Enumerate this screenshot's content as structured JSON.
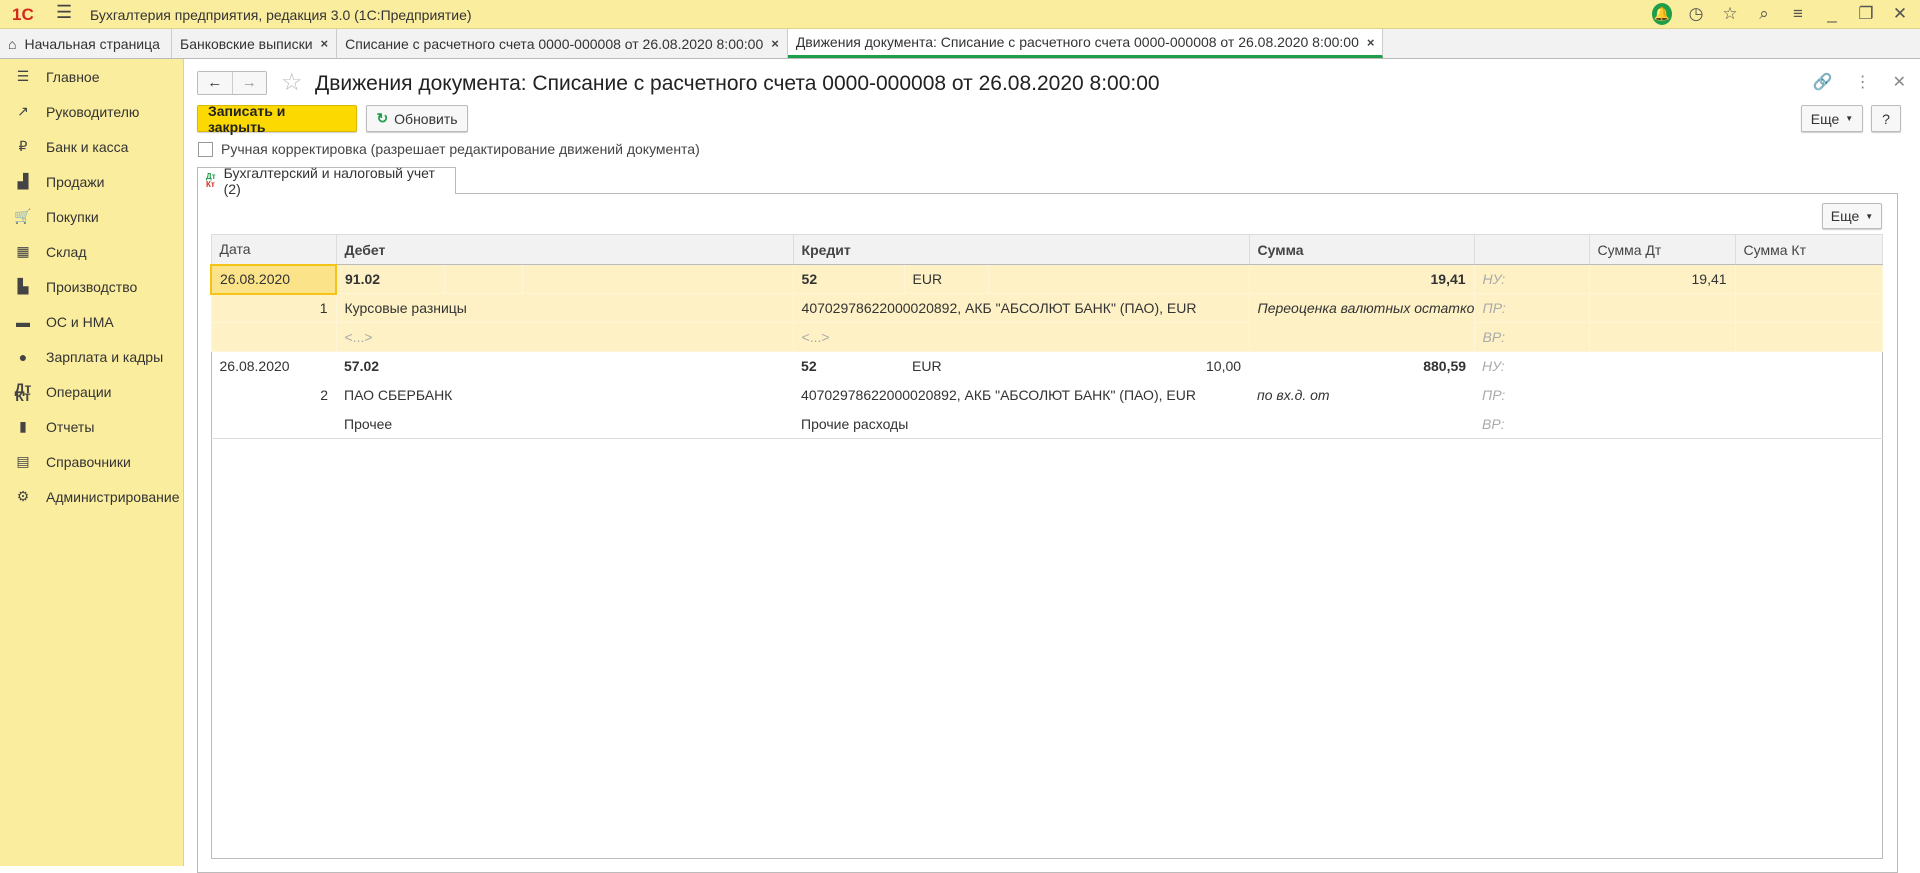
{
  "app": {
    "title": "Бухгалтерия предприятия, редакция 3.0  (1С:Предприятие)",
    "logo": "1С"
  },
  "tabs": [
    {
      "label": "Начальная страница"
    },
    {
      "label": "Банковские выписки"
    },
    {
      "label": "Списание с расчетного счета 0000-000008 от 26.08.2020 8:00:00"
    },
    {
      "label": "Движения документа: Списание с расчетного счета 0000-000008 от 26.08.2020 8:00:00"
    }
  ],
  "sidebar": {
    "items": [
      {
        "label": "Главное",
        "icon": "menu-icon"
      },
      {
        "label": "Руководителю",
        "icon": "trend-icon"
      },
      {
        "label": "Банк и касса",
        "icon": "ruble-icon"
      },
      {
        "label": "Продажи",
        "icon": "bag-icon"
      },
      {
        "label": "Покупки",
        "icon": "cart-icon"
      },
      {
        "label": "Склад",
        "icon": "warehouse-icon"
      },
      {
        "label": "Производство",
        "icon": "factory-icon"
      },
      {
        "label": "ОС и НМА",
        "icon": "truck-icon"
      },
      {
        "label": "Зарплата и кадры",
        "icon": "person-icon"
      },
      {
        "label": "Операции",
        "icon": "dtkt-icon"
      },
      {
        "label": "Отчеты",
        "icon": "chart-icon"
      },
      {
        "label": "Справочники",
        "icon": "books-icon"
      },
      {
        "label": "Администрирование",
        "icon": "gear-icon"
      }
    ]
  },
  "form": {
    "title": "Движения документа: Списание с расчетного счета 0000-000008 от 26.08.2020 8:00:00",
    "save_close": "Записать и закрыть",
    "refresh": "Обновить",
    "more": "Еще",
    "help": "?",
    "manual_label": "Ручная корректировка (разрешает редактирование движений документа)",
    "tab_label": "Бухгалтерский и налоговый учет (2)",
    "tab_icon_dt": "Дт",
    "tab_icon_kt": "Кт",
    "panel_more": "Еще"
  },
  "table": {
    "headers": [
      "Дата",
      "Дебет",
      "Кредит",
      "Сумма",
      "",
      "Сумма Дт",
      "Сумма Кт"
    ],
    "rows": [
      {
        "date": "26.08.2020",
        "num": "1",
        "dt_account": "91.02",
        "dt_sub1": "Курсовые разницы",
        "dt_sub2": "<...>",
        "kt_account": "52",
        "kt_currency": "EUR",
        "kt_amount_cur": "",
        "kt_sub1": "40702978622000020892, АКБ \"АБСОЛЮТ БАНК\" (ПАО), EUR",
        "kt_sub2": "<...>",
        "sum": "19,41",
        "content": "Переоценка валютных остатков",
        "nu": "НУ:",
        "pr": "ПР:",
        "vr": "ВР:",
        "sum_dt": "19,41",
        "sum_kt": ""
      },
      {
        "date": "26.08.2020",
        "num": "2",
        "dt_account": "57.02",
        "dt_sub1": "ПАО СБЕРБАНК",
        "dt_sub2": "Прочее",
        "kt_account": "52",
        "kt_currency": "EUR",
        "kt_amount_cur": "10,00",
        "kt_sub1": "40702978622000020892, АКБ \"АБСОЛЮТ БАНК\" (ПАО), EUR",
        "kt_sub2": "Прочие расходы",
        "sum": "880,59",
        "content": " по вх.д.  от",
        "nu": "НУ:",
        "pr": "ПР:",
        "vr": "ВР:",
        "sum_dt": "",
        "sum_kt": ""
      }
    ]
  }
}
